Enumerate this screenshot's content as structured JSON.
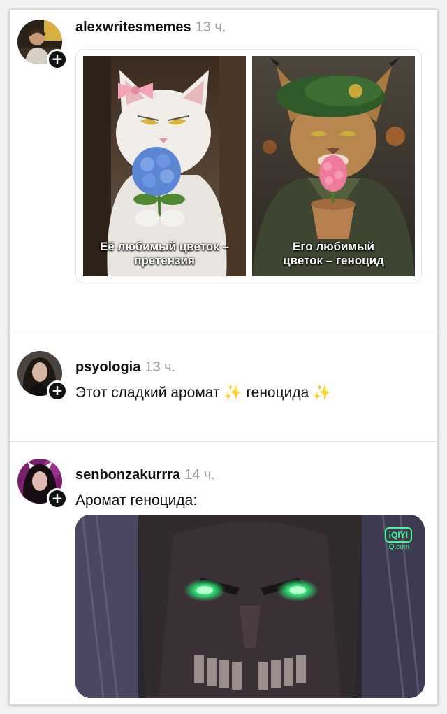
{
  "posts": [
    {
      "username": "alexwritesmemes",
      "time": "13 ч.",
      "meme": {
        "left_caption": "Её любимый цветок – претензия",
        "right_caption": "Его любимый цветок – геноцид"
      }
    },
    {
      "username": "psyologia",
      "time": "13 ч.",
      "text": "Этот сладкий аромат ✨ геноцида ✨"
    },
    {
      "username": "senbonzakurrra",
      "time": "14 ч.",
      "text": "Аромат геноцида:",
      "media": {
        "watermark": "iQIYI",
        "watermark_sub": "iQ.com"
      }
    }
  ],
  "colors": {
    "accent_green": "#3cff8a",
    "timestamp_gray": "#9a9a9a"
  },
  "icons": [
    "plus-icon"
  ]
}
